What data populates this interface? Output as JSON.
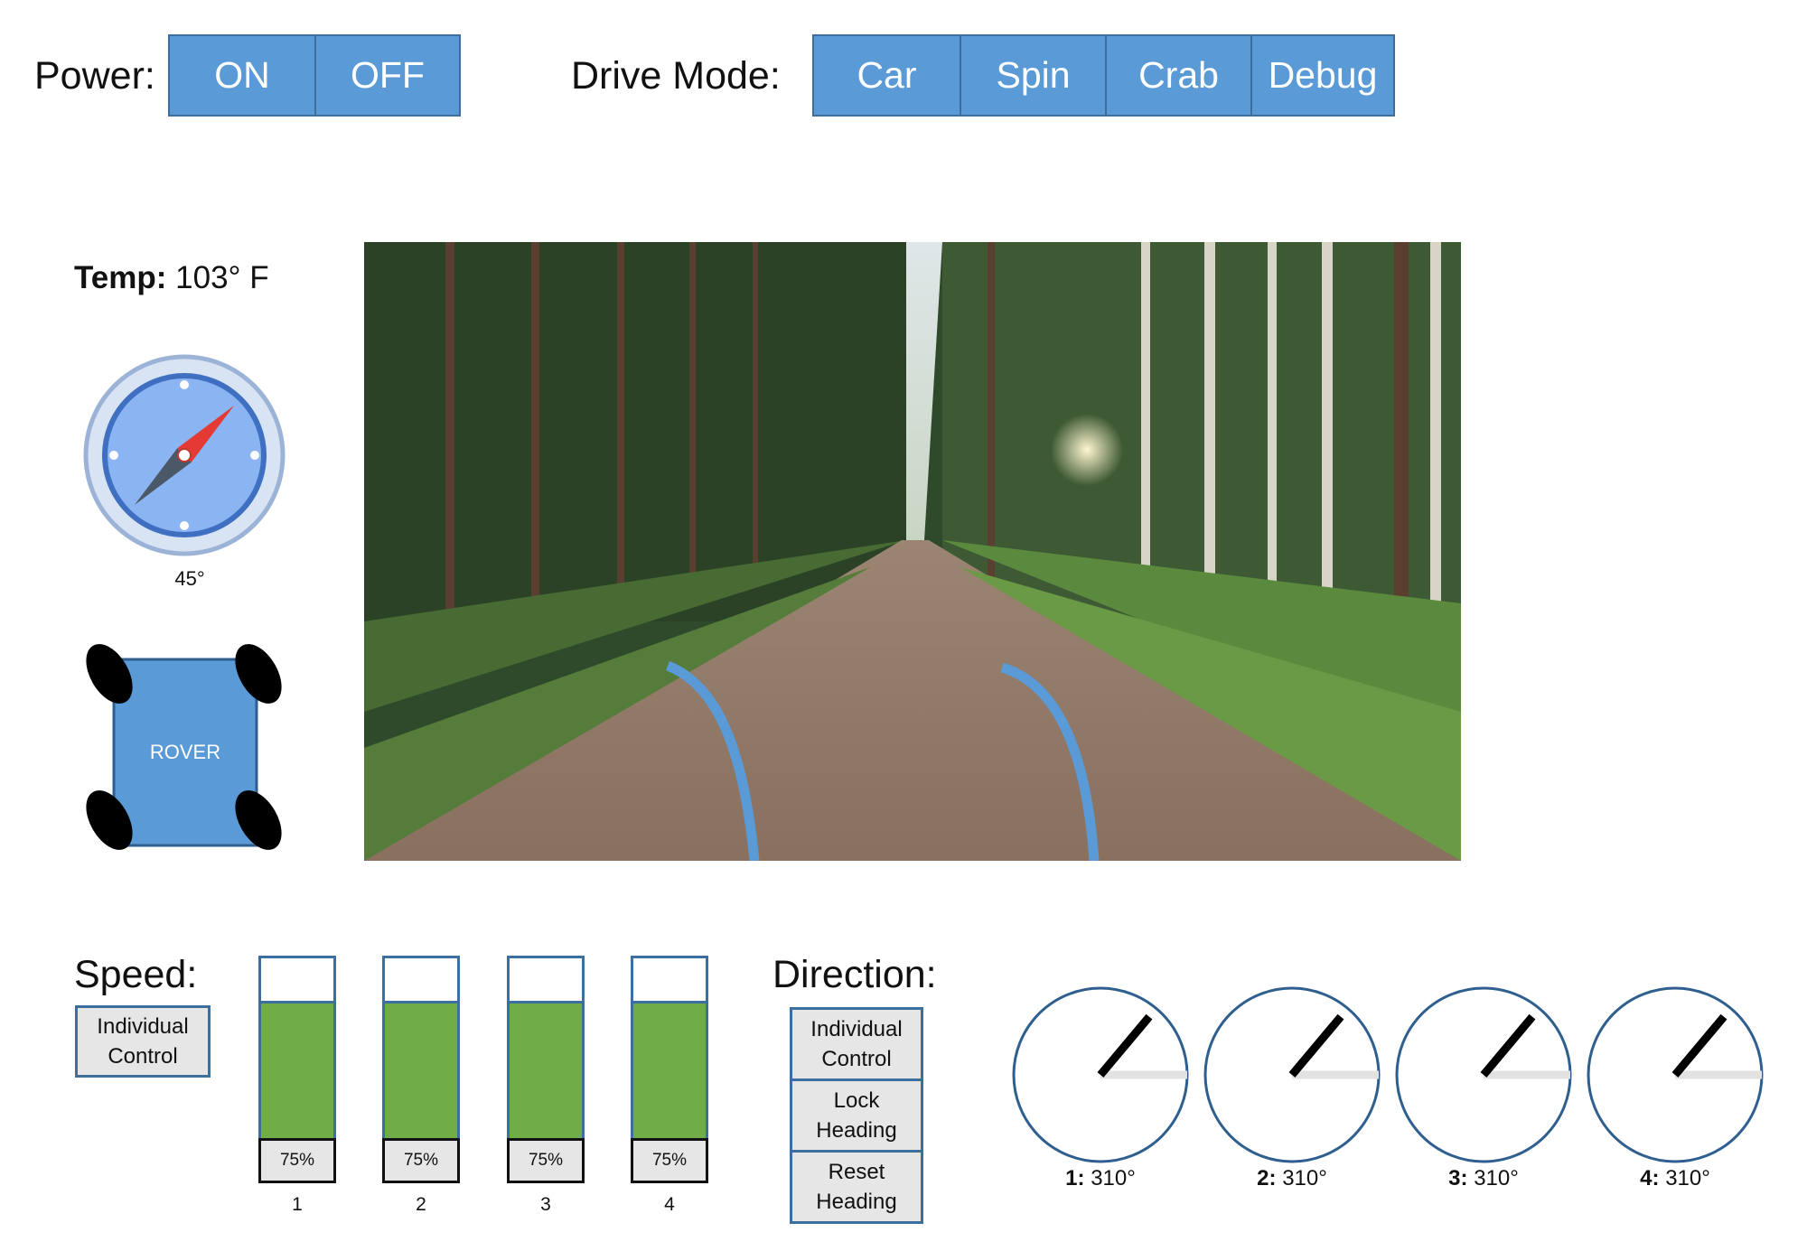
{
  "power": {
    "label": "Power:",
    "on_label": "ON",
    "off_label": "OFF"
  },
  "drive_mode": {
    "label": "Drive Mode:",
    "modes": [
      "Car",
      "Spin",
      "Crab",
      "Debug"
    ]
  },
  "temperature": {
    "label": "Temp:",
    "value": "103° F"
  },
  "compass": {
    "heading_text": "45°",
    "heading_deg": 45
  },
  "rover": {
    "label": "ROVER"
  },
  "speed": {
    "label": "Speed:",
    "individual_control_line1": "Individual",
    "individual_control_line2": "Control",
    "wheels": [
      {
        "num": "1",
        "pct_text": "75%",
        "fraction": 0.75
      },
      {
        "num": "2",
        "pct_text": "75%",
        "fraction": 0.75
      },
      {
        "num": "3",
        "pct_text": "75%",
        "fraction": 0.75
      },
      {
        "num": "4",
        "pct_text": "75%",
        "fraction": 0.75
      }
    ]
  },
  "direction": {
    "label": "Direction:",
    "individual_control_line1": "Individual",
    "individual_control_line2": "Control",
    "lock_heading_line1": "Lock",
    "lock_heading_line2": "Heading",
    "reset_heading_line1": "Reset",
    "reset_heading_line2": "Heading",
    "wheels": [
      {
        "num": "1:",
        "angle_text": "310°",
        "angle_deg": 310
      },
      {
        "num": "2:",
        "angle_text": "310°",
        "angle_deg": 310
      },
      {
        "num": "3:",
        "angle_text": "310°",
        "angle_deg": 310
      },
      {
        "num": "4:",
        "angle_text": "310°",
        "angle_deg": 310
      }
    ]
  },
  "colors": {
    "button_blue": "#5a9ad6",
    "border_blue": "#3d6f9e",
    "speed_green": "#70ad47",
    "button_gray": "#e6e6e6"
  }
}
